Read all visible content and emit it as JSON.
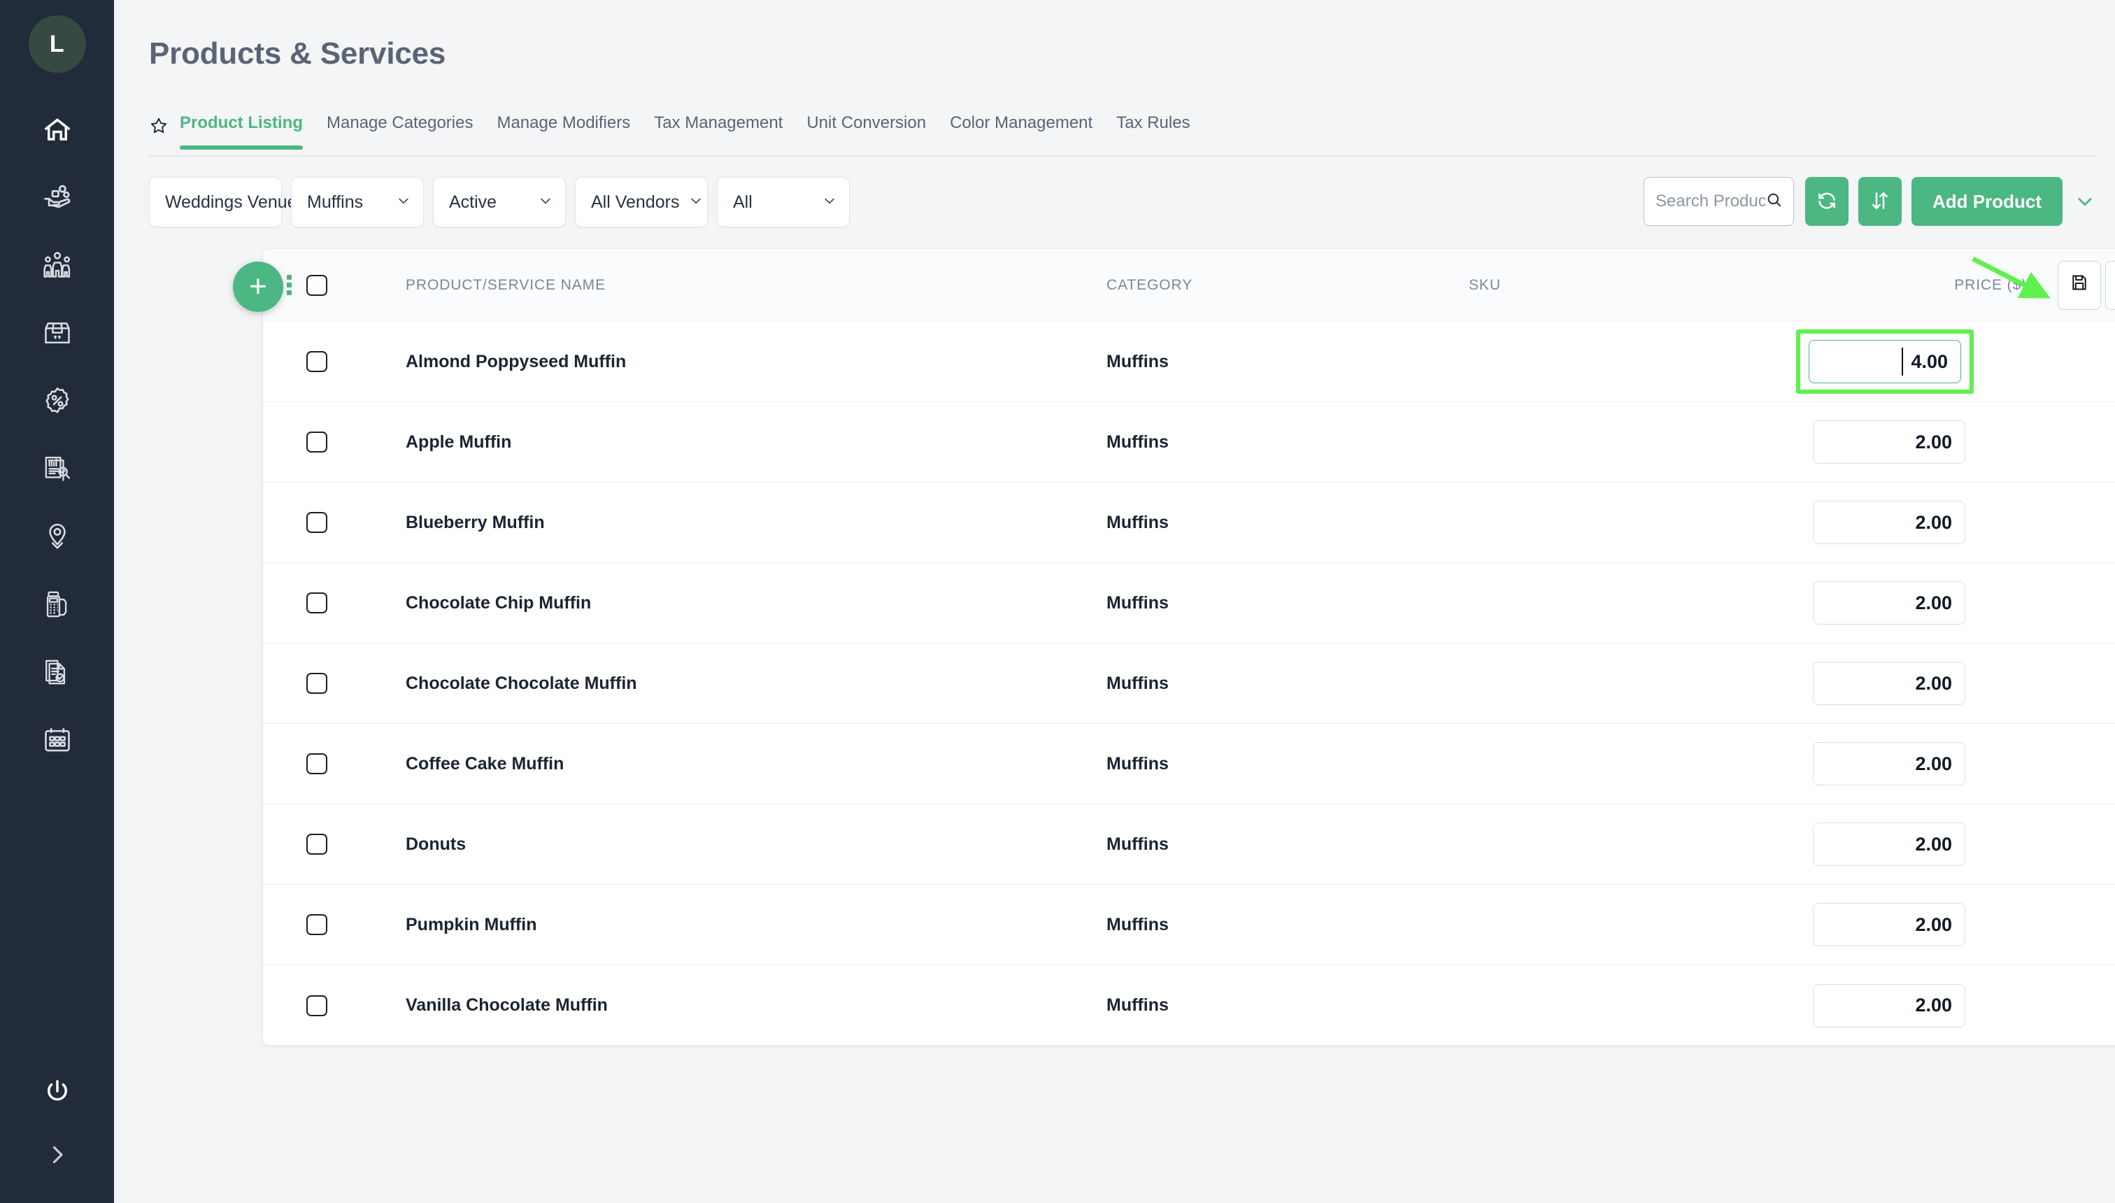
{
  "sidebar": {
    "avatar_initial": "L",
    "items": [
      {
        "name": "home",
        "icon": "home-icon"
      },
      {
        "name": "sales",
        "icon": "hand-coins-icon"
      },
      {
        "name": "customers",
        "icon": "people-group-icon"
      },
      {
        "name": "inventory",
        "icon": "box-package-icon"
      },
      {
        "name": "discounts",
        "icon": "percent-badge-icon"
      },
      {
        "name": "reports",
        "icon": "report-search-icon"
      },
      {
        "name": "locations",
        "icon": "map-pin-icon"
      },
      {
        "name": "terminal",
        "icon": "pos-terminal-icon"
      },
      {
        "name": "documents",
        "icon": "document-check-icon"
      },
      {
        "name": "calendar",
        "icon": "calendar-icon"
      }
    ],
    "bottom": [
      {
        "name": "logout",
        "icon": "power-icon"
      },
      {
        "name": "expand-sidebar",
        "icon": "chevron-right-icon"
      }
    ]
  },
  "header": {
    "title": "Products & Services",
    "favorite_icon": "star-icon"
  },
  "tabs": [
    {
      "label": "Product Listing",
      "active": true
    },
    {
      "label": "Manage Categories",
      "active": false
    },
    {
      "label": "Manage Modifiers",
      "active": false
    },
    {
      "label": "Tax Management",
      "active": false
    },
    {
      "label": "Unit Conversion",
      "active": false
    },
    {
      "label": "Color Management",
      "active": false
    },
    {
      "label": "Tax Rules",
      "active": false
    }
  ],
  "filters": [
    {
      "name": "venue",
      "value": "Weddings Venue"
    },
    {
      "name": "category",
      "value": "Muffins"
    },
    {
      "name": "status",
      "value": "Active"
    },
    {
      "name": "vendor",
      "value": "All Vendors"
    },
    {
      "name": "type",
      "value": "All"
    }
  ],
  "toolbar": {
    "search_placeholder": "Search Product or Sku",
    "search_value": "",
    "search_icon": "search-icon",
    "refresh_icon": "refresh-icon",
    "sort_icon": "sort-arrows-icon",
    "add_product_label": "Add Product",
    "more_caret_icon": "chevron-down-icon",
    "add_row_label": "+"
  },
  "table": {
    "columns": [
      "PRODUCT/SERVICE NAME",
      "CATEGORY",
      "SKU",
      "PRICE ($)"
    ],
    "header_actions": [
      {
        "name": "save-changes",
        "icon": "floppy-save-icon",
        "label": "💾"
      },
      {
        "name": "cancel-changes",
        "icon": "close-x-icon",
        "label": "✖"
      }
    ],
    "rows": [
      {
        "name": "Almond Poppyseed Muffin",
        "category": "Muffins",
        "sku": "",
        "price": "4.00",
        "editing": true
      },
      {
        "name": "Apple Muffin",
        "category": "Muffins",
        "sku": "",
        "price": "2.00",
        "editing": false
      },
      {
        "name": "Blueberry Muffin",
        "category": "Muffins",
        "sku": "",
        "price": "2.00",
        "editing": false
      },
      {
        "name": "Chocolate Chip Muffin",
        "category": "Muffins",
        "sku": "",
        "price": "2.00",
        "editing": false
      },
      {
        "name": "Chocolate Chocolate Muffin",
        "category": "Muffins",
        "sku": "",
        "price": "2.00",
        "editing": false
      },
      {
        "name": "Coffee Cake Muffin",
        "category": "Muffins",
        "sku": "",
        "price": "2.00",
        "editing": false
      },
      {
        "name": "Donuts",
        "category": "Muffins",
        "sku": "",
        "price": "2.00",
        "editing": false
      },
      {
        "name": "Pumpkin Muffin",
        "category": "Muffins",
        "sku": "",
        "price": "2.00",
        "editing": false
      },
      {
        "name": "Vanilla Chocolate Muffin",
        "category": "Muffins",
        "sku": "",
        "price": "2.00",
        "editing": false
      }
    ]
  },
  "annotation": {
    "arrow_icon": "green-arrow-pointing-to-save",
    "highlight_color": "#5ef24f",
    "target": "save-changes"
  },
  "colors": {
    "sidebar_bg": "#222b3a",
    "accent_green": "#4cb782",
    "page_bg": "#f4f5f7",
    "title_text": "#5a6476",
    "annotation_green": "#5ef24f"
  }
}
